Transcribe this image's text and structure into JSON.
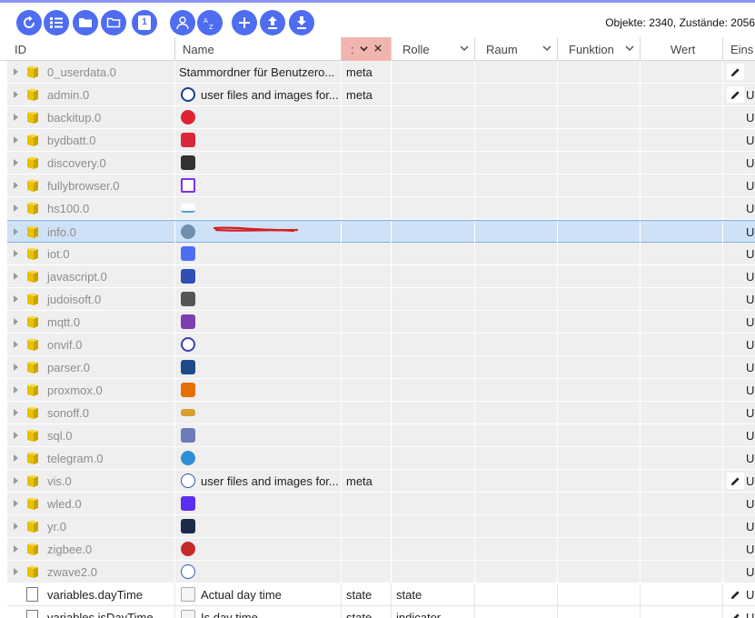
{
  "toolbar": {
    "buttons": [
      "refresh-icon",
      "list-icon",
      "folder-icon",
      "folder-outline-icon",
      "number-icon",
      "person-settings-icon",
      "sort-az-icon",
      "plus-icon",
      "upload-icon",
      "download-icon"
    ],
    "number_label": "1",
    "stats": "Objekte: 2340, Zustände: 2056"
  },
  "columns": {
    "id": "ID",
    "name": "Name",
    "type": ":",
    "role": "Rolle",
    "room": "Raum",
    "function": "Funktion",
    "value": "Wert",
    "settings": "Eins"
  },
  "rows": [
    {
      "id": "0_userdata.0",
      "name": "Stammordner für Benutzero...",
      "type": "meta",
      "role": "",
      "icon": "none",
      "edit": true,
      "u": false,
      "color": ""
    },
    {
      "id": "admin.0",
      "name": "user files and images for...",
      "type": "meta",
      "role": "",
      "icon": "admin-icon",
      "edit": true,
      "u": true,
      "color": "#1b3e8f"
    },
    {
      "id": "backitup.0",
      "name": "",
      "type": "",
      "role": "",
      "icon": "backitup-icon",
      "edit": false,
      "u": true,
      "color": "#e02332"
    },
    {
      "id": "bydbatt.0",
      "name": "",
      "type": "",
      "role": "",
      "icon": "bydbatt-icon",
      "edit": false,
      "u": true,
      "color": "#d9283a"
    },
    {
      "id": "discovery.0",
      "name": "",
      "type": "",
      "role": "",
      "icon": "discovery-icon",
      "edit": false,
      "u": true,
      "color": "#333333"
    },
    {
      "id": "fullybrowser.0",
      "name": "",
      "type": "",
      "role": "",
      "icon": "fullybrowser-icon",
      "edit": false,
      "u": true,
      "color": "#7b2ff7"
    },
    {
      "id": "hs100.0",
      "name": "",
      "type": "",
      "role": "",
      "icon": "hs100-icon",
      "edit": false,
      "u": true,
      "color": "#4aa3d8"
    },
    {
      "id": "info.0",
      "name": "",
      "type": "",
      "role": "",
      "icon": "info-icon",
      "edit": false,
      "u": true,
      "color": "#6f8fb0"
    },
    {
      "id": "iot.0",
      "name": "",
      "type": "",
      "role": "",
      "icon": "iot-icon",
      "edit": false,
      "u": true,
      "color": "#4f6df0"
    },
    {
      "id": "javascript.0",
      "name": "",
      "type": "",
      "role": "",
      "icon": "javascript-icon",
      "edit": false,
      "u": true,
      "color": "#2f4fb5"
    },
    {
      "id": "judoisoft.0",
      "name": "",
      "type": "",
      "role": "",
      "icon": "judoisoft-icon",
      "edit": false,
      "u": true,
      "color": "#555555"
    },
    {
      "id": "mqtt.0",
      "name": "",
      "type": "",
      "role": "",
      "icon": "mqtt-icon",
      "edit": false,
      "u": true,
      "color": "#7d3fb0"
    },
    {
      "id": "onvif.0",
      "name": "",
      "type": "",
      "role": "",
      "icon": "onvif-icon",
      "edit": false,
      "u": true,
      "color": "#3b3fb5"
    },
    {
      "id": "parser.0",
      "name": "",
      "type": "",
      "role": "",
      "icon": "parser-icon",
      "edit": false,
      "u": true,
      "color": "#1f4a8a"
    },
    {
      "id": "proxmox.0",
      "name": "",
      "type": "",
      "role": "",
      "icon": "proxmox-icon",
      "edit": false,
      "u": true,
      "color": "#e57000"
    },
    {
      "id": "sonoff.0",
      "name": "",
      "type": "",
      "role": "",
      "icon": "sonoff-icon",
      "edit": false,
      "u": true,
      "color": "#d7a030"
    },
    {
      "id": "sql.0",
      "name": "",
      "type": "",
      "role": "",
      "icon": "sql-icon",
      "edit": false,
      "u": true,
      "color": "#6d7bb8"
    },
    {
      "id": "telegram.0",
      "name": "",
      "type": "",
      "role": "",
      "icon": "telegram-icon",
      "edit": false,
      "u": true,
      "color": "#2f8fd6"
    },
    {
      "id": "vis.0",
      "name": "user files and images for...",
      "type": "meta",
      "role": "",
      "icon": "vis-icon",
      "edit": true,
      "u": true,
      "color": "#2a5aa8"
    },
    {
      "id": "wled.0",
      "name": "",
      "type": "",
      "role": "",
      "icon": "wled-icon",
      "edit": false,
      "u": true,
      "color": "#5a2ff0"
    },
    {
      "id": "yr.0",
      "name": "",
      "type": "",
      "role": "",
      "icon": "yr-icon",
      "edit": false,
      "u": true,
      "color": "#1b2c4a"
    },
    {
      "id": "zigbee.0",
      "name": "",
      "type": "",
      "role": "",
      "icon": "zigbee-icon",
      "edit": false,
      "u": true,
      "color": "#c62b2b"
    },
    {
      "id": "zwave2.0",
      "name": "",
      "type": "",
      "role": "",
      "icon": "zwave-icon",
      "edit": false,
      "u": true,
      "color": "#2f5fb0"
    },
    {
      "id": "variables.dayTime",
      "name": "Actual day time",
      "type": "state",
      "role": "state",
      "icon": "state-icon",
      "edit": true,
      "u": true,
      "color": "#999999"
    },
    {
      "id": "variables.isDayTime",
      "name": "Is day time",
      "type": "state",
      "role": "indicator",
      "icon": "state-icon",
      "edit": true,
      "u": true,
      "color": "#999999"
    }
  ],
  "u_label": "U",
  "colors": {
    "accent": "#4f6df0",
    "selected_header": "#f1b5b0",
    "highlight_row": "#cfe1f6",
    "folder": "#e6c200"
  }
}
